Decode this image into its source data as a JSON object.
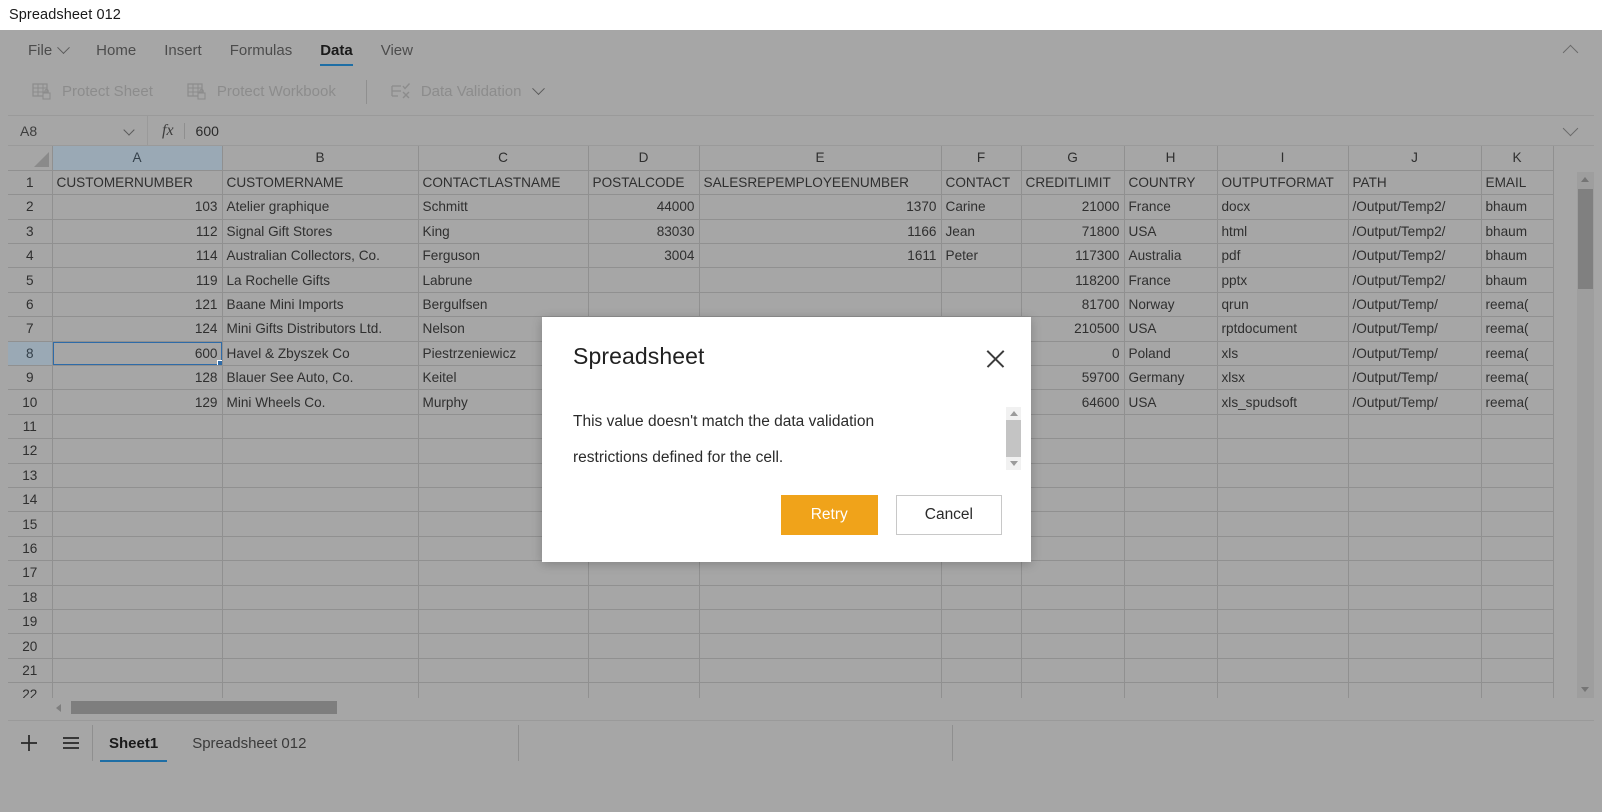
{
  "window": {
    "title": "Spreadsheet 012"
  },
  "ribbon": {
    "tabs": [
      {
        "label": "File",
        "active": false,
        "has_chevron": true
      },
      {
        "label": "Home",
        "active": false,
        "has_chevron": false
      },
      {
        "label": "Insert",
        "active": false,
        "has_chevron": false
      },
      {
        "label": "Formulas",
        "active": false,
        "has_chevron": false
      },
      {
        "label": "Data",
        "active": true,
        "has_chevron": false
      },
      {
        "label": "View",
        "active": false,
        "has_chevron": false
      }
    ],
    "collapse_icon": "chevron-up-icon",
    "tools": [
      {
        "label": "Protect Sheet",
        "icon": "protect-sheet-icon",
        "disabled": true
      },
      {
        "label": "Protect Workbook",
        "icon": "protect-workbook-icon",
        "disabled": true
      },
      {
        "label": "Data Validation",
        "icon": "data-validation-icon",
        "disabled": true,
        "has_chevron": true
      }
    ]
  },
  "formula_bar": {
    "name_box_value": "A8",
    "fx_label": "fx",
    "formula_value": "600",
    "expand_icon": "chevron-down-icon"
  },
  "grid": {
    "columns": [
      "A",
      "B",
      "C",
      "D",
      "E",
      "F",
      "G",
      "H",
      "I",
      "J",
      "K"
    ],
    "selected_column": "A",
    "selected_row": 8,
    "selected_cell": "A8",
    "row_count": 22,
    "headers": [
      "CUSTOMERNUMBER",
      "CUSTOMERNAME",
      "CONTACTLASTNAME",
      "POSTALCODE",
      "SALESREPEMPLOYEENUMBER",
      "CONTACT",
      "CREDITLIMIT",
      "COUNTRY",
      "OUTPUTFORMAT",
      "PATH",
      "EMAIL"
    ],
    "rows": [
      [
        "103",
        "Atelier graphique",
        "Schmitt",
        "44000",
        "1370",
        "Carine",
        "21000",
        "France",
        "docx",
        "/Output/Temp2/",
        "bhaum"
      ],
      [
        "112",
        "Signal Gift Stores",
        "King",
        "83030",
        "1166",
        "Jean",
        "71800",
        "USA",
        "html",
        "/Output/Temp2/",
        "bhaum"
      ],
      [
        "114",
        "Australian Collectors, Co.",
        "Ferguson",
        "3004",
        "1611",
        "Peter",
        "117300",
        "Australia",
        "pdf",
        "/Output/Temp2/",
        "bhaum"
      ],
      [
        "119",
        "La Rochelle Gifts",
        "Labrune",
        "",
        "",
        "",
        "118200",
        "France",
        "pptx",
        "/Output/Temp2/",
        "bhaum"
      ],
      [
        "121",
        "Baane Mini Imports",
        "Bergulfsen",
        "",
        "",
        "",
        "81700",
        "Norway",
        "qrun",
        "/Output/Temp/",
        "reema("
      ],
      [
        "124",
        "Mini Gifts Distributors Ltd.",
        "Nelson",
        "",
        "",
        "",
        "210500",
        "USA",
        "rptdocument",
        "/Output/Temp/",
        "reema("
      ],
      [
        "600",
        "Havel & Zbyszek Co",
        "Piestrzeniewicz",
        "",
        "",
        "",
        "0",
        "Poland",
        "xls",
        "/Output/Temp/",
        "reema("
      ],
      [
        "128",
        "Blauer See Auto, Co.",
        "Keitel",
        "",
        "",
        "",
        "59700",
        "Germany",
        "xlsx",
        "/Output/Temp/",
        "reema("
      ],
      [
        "129",
        "Mini Wheels Co.",
        "Murphy",
        "",
        "",
        "",
        "64600",
        "USA",
        "xls_spudsoft",
        "/Output/Temp/",
        "reema("
      ]
    ]
  },
  "sheet_bar": {
    "add_icon": "plus-icon",
    "menu_icon": "hamburger-icon",
    "tabs": [
      {
        "label": "Sheet1",
        "active": true
      },
      {
        "label": "Spreadsheet 012",
        "active": false
      }
    ]
  },
  "dialog": {
    "title": "Spreadsheet",
    "close_icon": "close-icon",
    "message_line1": "This value doesn't match the data validation",
    "message_line2": "restrictions defined for the cell.",
    "primary_button": "Retry",
    "secondary_button": "Cancel",
    "primary_color": "#f0a31a"
  }
}
